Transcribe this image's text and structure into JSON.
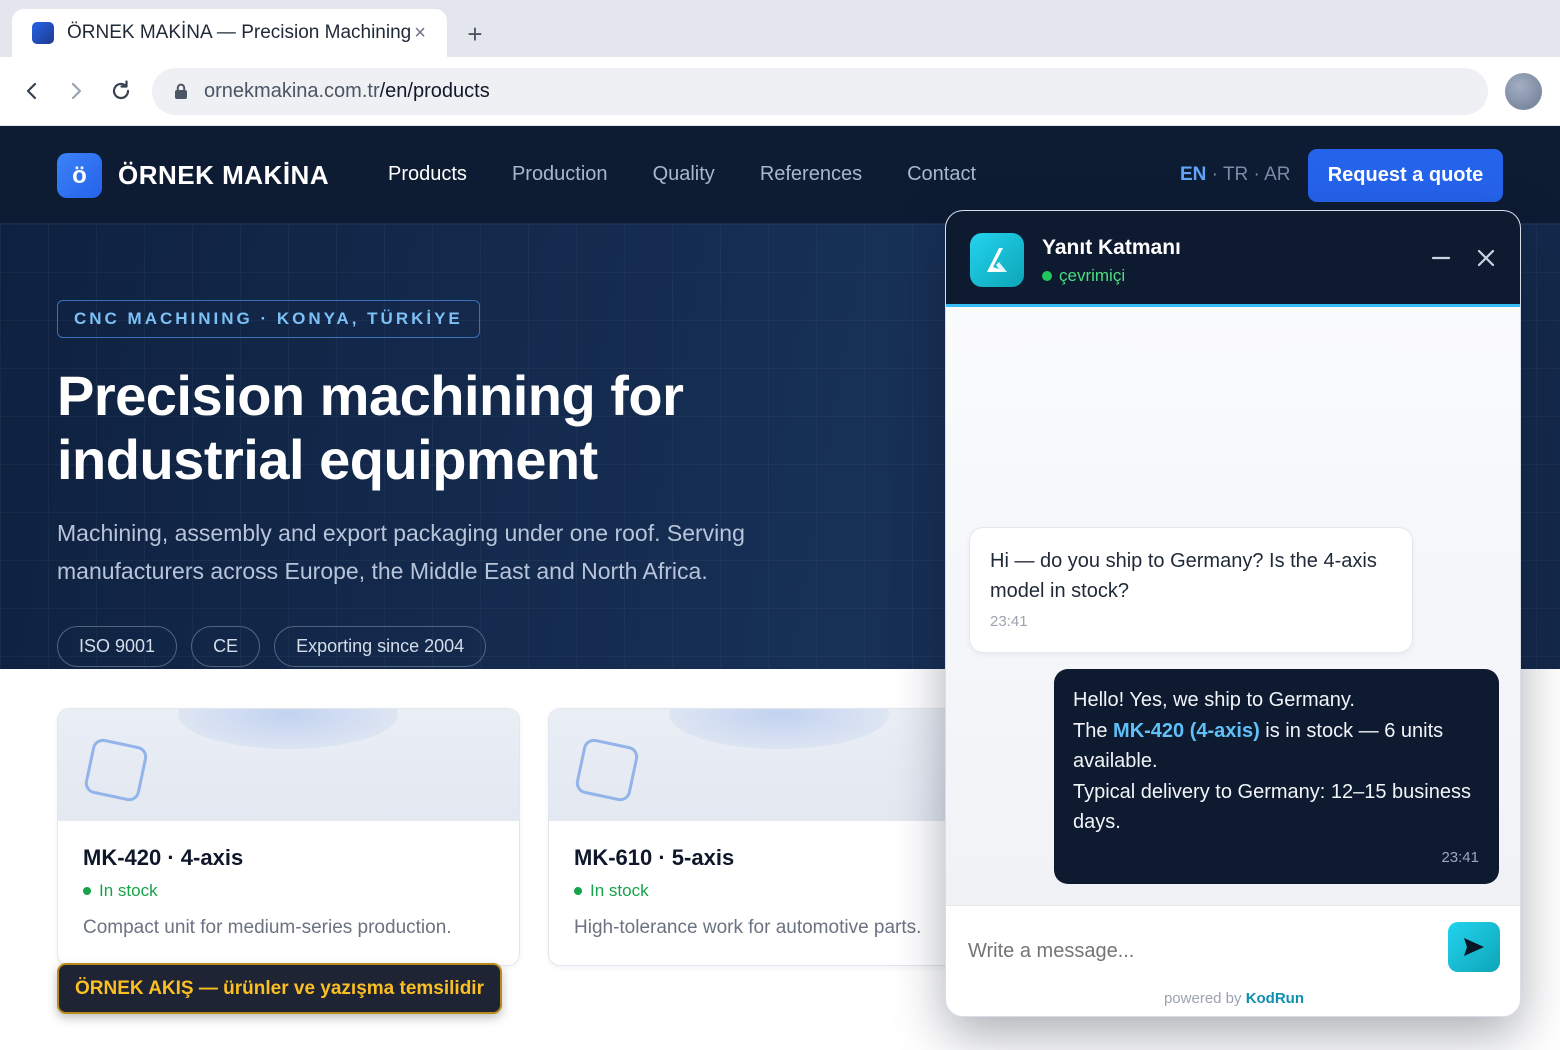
{
  "browser": {
    "tab_title": "ÖRNEK MAKİNA — Precision Machining",
    "tab_close": "×",
    "new_tab": "+",
    "url_host": "ornekmakina.com.tr",
    "url_path": "/en/products"
  },
  "site": {
    "logo_mark": "ö",
    "logo_text": "ÖRNEK MAKİNA",
    "nav": [
      "Products",
      "Production",
      "Quality",
      "References",
      "Contact"
    ],
    "nav_active": "Products",
    "lang_current": "EN",
    "lang_others": " · TR · AR",
    "cta": "Request a quote"
  },
  "hero": {
    "eyebrow": "CNC MACHINING · KONYA, TÜRKİYE",
    "title": "Precision machining for industrial equipment",
    "subtitle": "Machining, assembly and export packaging under one roof. Serving manufacturers across Europe, the Middle East and North Africa.",
    "badges": [
      "ISO 9001",
      "CE",
      "Exporting since 2004"
    ]
  },
  "products": [
    {
      "title": "MK-420 · 4-axis",
      "stock": "In stock",
      "desc": "Compact unit for medium-series production."
    },
    {
      "title": "MK-610 · 5-axis",
      "stock": "In stock",
      "desc": "High-tolerance work for automotive parts."
    }
  ],
  "demo_badge": "ÖRNEK AKIŞ — ürünler ve yazışma temsilidir",
  "chat": {
    "agent_name": "Yanıt Katmanı",
    "status": "çevrimiçi",
    "incoming": {
      "text": "Hi — do you ship to Germany? Is the 4-axis model in stock?",
      "time": "23:41"
    },
    "outgoing": {
      "line1": "Hello! Yes, we ship to Germany.",
      "line2_prefix": "The ",
      "line2_highlight": "MK-420 (4-axis)",
      "line2_suffix": " is in stock — 6 units available.",
      "line3": "Typical delivery to Germany: 12–15 business days.",
      "time": "23:41"
    },
    "input_placeholder": "Write a message...",
    "powered_prefix": "powered by ",
    "powered_brand": "KodRun"
  },
  "colors": {
    "header_bg": "#0d1b33",
    "accent_blue": "#2563eb",
    "chat_accent": "#22d3ee",
    "stock_green": "#16a34a",
    "badge_gold": "#fbbf24"
  },
  "icons": {
    "back": "arrow-left-icon",
    "forward": "arrow-right-icon",
    "reload": "reload-icon",
    "lock": "lock-icon",
    "minimize": "minimize-icon",
    "close": "close-icon",
    "send": "send-icon",
    "product": "product-placeholder-icon"
  }
}
